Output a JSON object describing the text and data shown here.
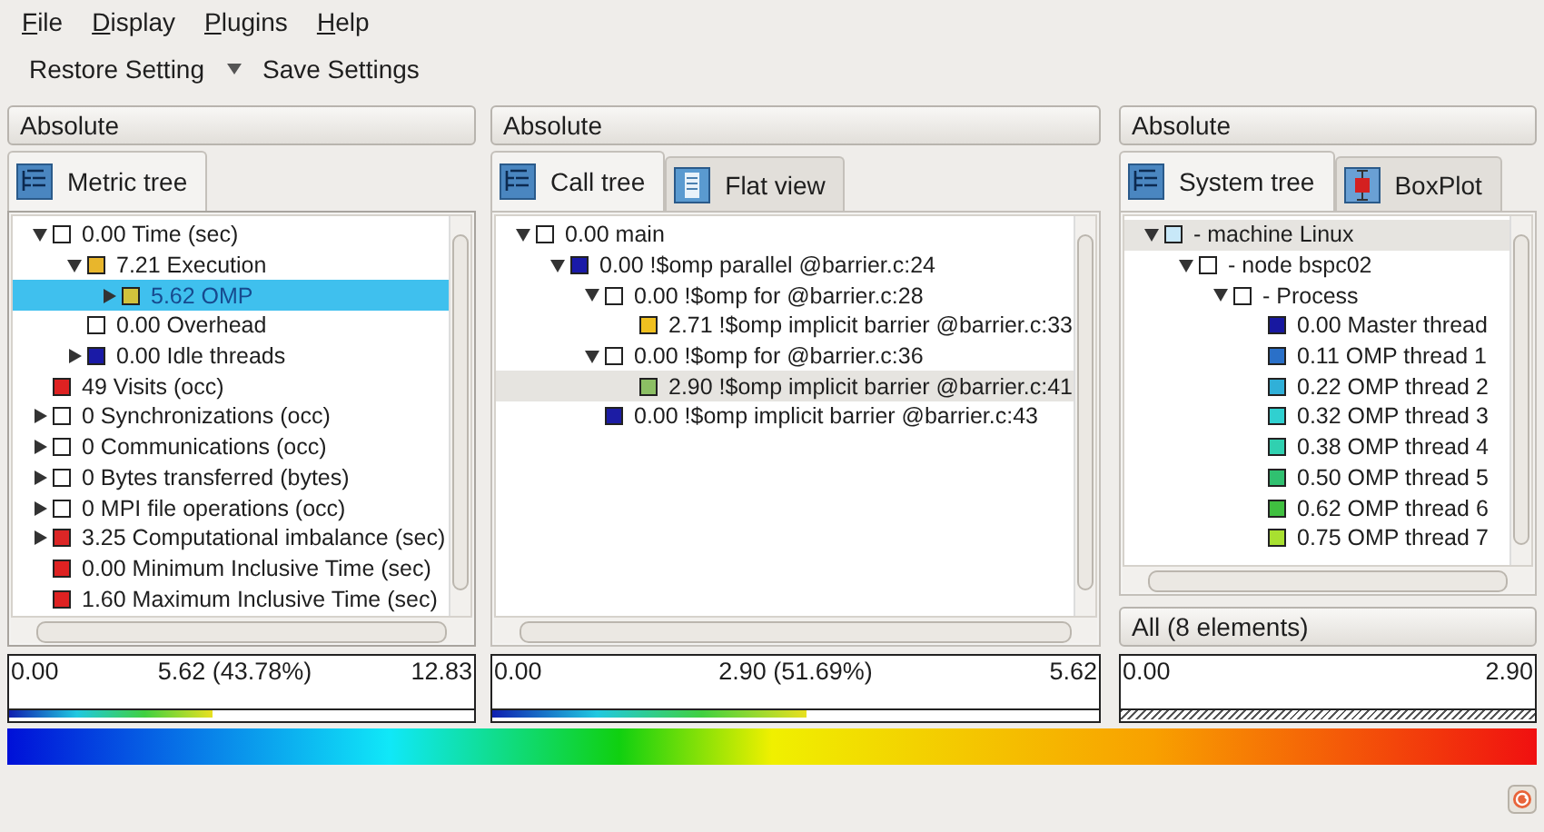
{
  "menu": [
    "File",
    "Display",
    "Plugins",
    "Help"
  ],
  "toolbar": [
    {
      "kind": "button",
      "label": "Restore Setting"
    },
    {
      "kind": "dropdown"
    },
    {
      "kind": "button",
      "label": "Save Settings"
    }
  ],
  "panels": [
    {
      "mode": "Absolute",
      "focused": true,
      "tabs": [
        {
          "label": "Metric tree",
          "kind": "tree",
          "selected": true
        }
      ],
      "tree": [
        {
          "label": "0.00 Time (sec)",
          "color": "#ffffff",
          "kind": "expanded",
          "selected": false,
          "children": [
            {
              "label": "7.21 Execution",
              "color": "#e8b62c",
              "kind": "expanded",
              "selected": false,
              "children": [
                {
                  "label": "5.62 OMP",
                  "color": "#d2c23c",
                  "kind": "collapsed",
                  "selected": true
                }
              ]
            },
            {
              "label": "0.00 Overhead",
              "color": "#ffffff",
              "kind": "leaf",
              "selected": false
            },
            {
              "label": "0.00 Idle threads",
              "color": "#1a1aa6",
              "kind": "collapsed",
              "selected": false
            }
          ]
        },
        {
          "label": "49 Visits (occ)",
          "color": "#de2222",
          "kind": "leaf",
          "selected": false
        },
        {
          "label": "0 Synchronizations (occ)",
          "color": "#ffffff",
          "kind": "collapsed",
          "selected": false
        },
        {
          "label": "0 Communications (occ)",
          "color": "#ffffff",
          "kind": "collapsed",
          "selected": false
        },
        {
          "label": "0 Bytes transferred (bytes)",
          "color": "#ffffff",
          "kind": "collapsed",
          "selected": false
        },
        {
          "label": "0 MPI file operations (occ)",
          "color": "#ffffff",
          "kind": "collapsed",
          "selected": false
        },
        {
          "label": "3.25 Computational imbalance (sec)",
          "color": "#dc2626",
          "kind": "collapsed",
          "selected": false
        },
        {
          "label": "0.00 Minimum Inclusive Time (sec)",
          "color": "#de2222",
          "kind": "leaf",
          "selected": false
        },
        {
          "label": "1.60 Maximum Inclusive Time (sec)",
          "color": "#de2222",
          "kind": "leaf",
          "selected": false
        }
      ],
      "scale": {
        "kind": "gradient",
        "min": "0.00",
        "value": "5.62 (43.78%)",
        "max": "12.83",
        "level": 0.4378
      }
    },
    {
      "mode": "Absolute",
      "focused": false,
      "tabs": [
        {
          "label": "Call tree",
          "kind": "tree",
          "selected": true
        },
        {
          "label": "Flat view",
          "kind": "list",
          "selected": false
        }
      ],
      "tree": [
        {
          "label": "0.00 main",
          "color": "#ffffff",
          "kind": "expanded",
          "selected": false,
          "children": [
            {
              "label": "0.00 !$omp parallel @barrier.c:24",
              "color": "#1a1aa8",
              "kind": "expanded",
              "selected": false,
              "children": [
                {
                  "label": "0.00 !$omp for @barrier.c:28",
                  "color": "#ffffff",
                  "kind": "expanded",
                  "selected": false,
                  "children": [
                    {
                      "label": "2.71 !$omp implicit barrier @barrier.c:33",
                      "color": "#f0c020",
                      "kind": "leaf",
                      "selected": false
                    }
                  ]
                },
                {
                  "label": "0.00 !$omp for @barrier.c:36",
                  "color": "#ffffff",
                  "kind": "expanded",
                  "selected": false,
                  "children": [
                    {
                      "label": "2.90 !$omp implicit barrier @barrier.c:41",
                      "color": "#8cbf64",
                      "kind": "leaf",
                      "selected": true
                    }
                  ]
                },
                {
                  "label": "0.00 !$omp implicit barrier @barrier.c:43",
                  "color": "#1c1ca4",
                  "kind": "leaf",
                  "selected": false
                }
              ]
            }
          ]
        }
      ],
      "scale": {
        "kind": "gradient",
        "min": "0.00",
        "value": "2.90 (51.69%)",
        "max": "5.62",
        "level": 0.5169
      }
    },
    {
      "mode": "Absolute",
      "focused": false,
      "tabs": [
        {
          "label": "System tree",
          "kind": "tree",
          "selected": true
        },
        {
          "label": "BoxPlot",
          "kind": "boxplot",
          "selected": false
        }
      ],
      "tree": [
        {
          "label": "- machine Linux",
          "color": "#c8e8f8",
          "kind": "expanded",
          "selected": true,
          "children": [
            {
              "label": "- node bspc02",
              "color": "#ffffff",
              "kind": "expanded",
              "selected": false,
              "children": [
                {
                  "label": "- Process",
                  "color": "#ffffff",
                  "kind": "expanded",
                  "selected": false,
                  "children": [
                    {
                      "label": "0.00 Master thread",
                      "color": "#1818a0",
                      "kind": "leaf",
                      "selected": false
                    },
                    {
                      "label": "0.11 OMP thread 1",
                      "color": "#2a70c8",
                      "kind": "leaf",
                      "selected": false
                    },
                    {
                      "label": "0.22 OMP thread 2",
                      "color": "#30b0d8",
                      "kind": "leaf",
                      "selected": false
                    },
                    {
                      "label": "0.32 OMP thread 3",
                      "color": "#30d0d0",
                      "kind": "leaf",
                      "selected": false
                    },
                    {
                      "label": "0.38 OMP thread 4",
                      "color": "#30d0b0",
                      "kind": "leaf",
                      "selected": false
                    },
                    {
                      "label": "0.50 OMP thread 5",
                      "color": "#30c070",
                      "kind": "leaf",
                      "selected": false
                    },
                    {
                      "label": "0.62 OMP thread 6",
                      "color": "#40c040",
                      "kind": "leaf",
                      "selected": false
                    },
                    {
                      "label": "0.75 OMP thread 7",
                      "color": "#a8e030",
                      "kind": "leaf",
                      "selected": false
                    }
                  ]
                }
              ]
            }
          ]
        }
      ],
      "filter": "All (8 elements)",
      "scale": {
        "kind": "hatched",
        "min": "0.00",
        "max": "2.90"
      }
    }
  ]
}
